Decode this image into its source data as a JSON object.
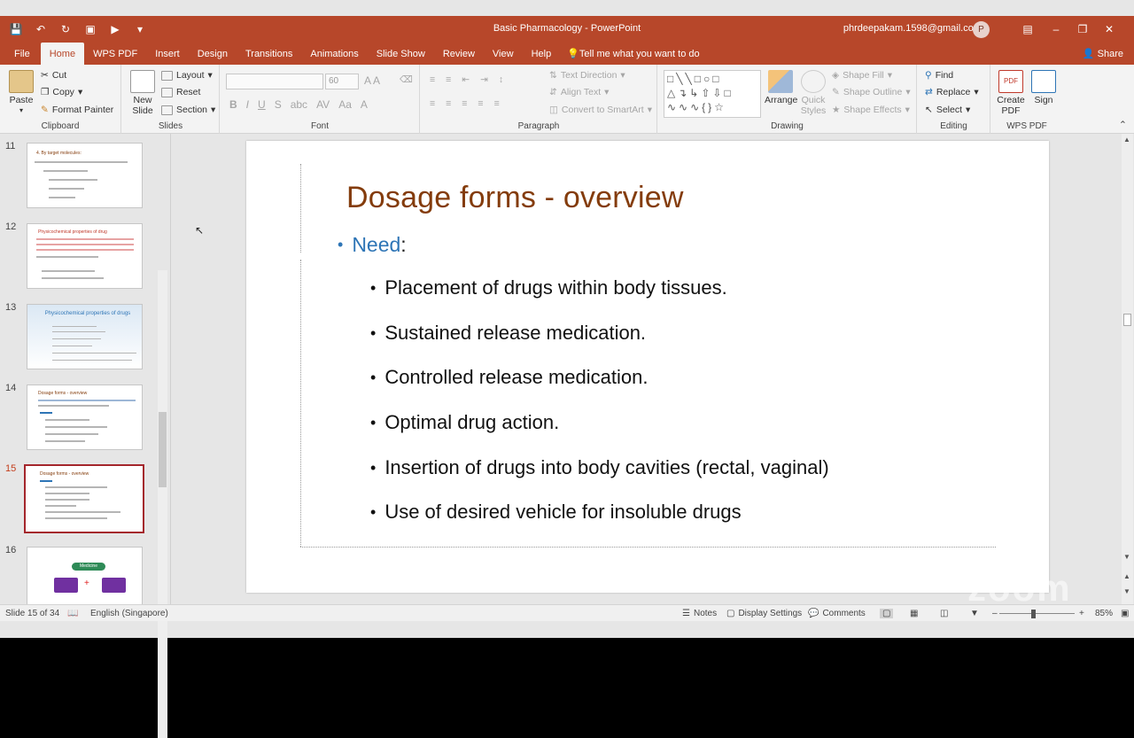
{
  "window": {
    "title": "Basic Pharmacology - PowerPoint",
    "account": "phrdeepakam.1598@gmail.com",
    "avatar_initial": "P"
  },
  "tabs": [
    "File",
    "Home",
    "WPS PDF",
    "Insert",
    "Design",
    "Transitions",
    "Animations",
    "Slide Show",
    "Review",
    "View",
    "Help"
  ],
  "active_tab": "Home",
  "tell_me": "Tell me what you want to do",
  "share": "Share",
  "ribbon": {
    "clipboard": {
      "paste": "Paste",
      "cut": "Cut",
      "copy": "Copy",
      "format_painter": "Format Painter",
      "label": "Clipboard"
    },
    "slides": {
      "new_slide": "New Slide",
      "layout": "Layout",
      "reset": "Reset",
      "section": "Section",
      "label": "Slides"
    },
    "font": {
      "size": "60",
      "label": "Font"
    },
    "paragraph": {
      "text_direction": "Text Direction",
      "align_text": "Align Text",
      "smartart": "Convert to SmartArt",
      "label": "Paragraph"
    },
    "drawing": {
      "arrange": "Arrange",
      "quick_styles": "Quick Styles",
      "shape_fill": "Shape Fill",
      "shape_outline": "Shape Outline",
      "shape_effects": "Shape Effects",
      "label": "Drawing"
    },
    "editing": {
      "find": "Find",
      "replace": "Replace",
      "select": "Select",
      "label": "Editing"
    },
    "wps": {
      "create_pdf": "Create PDF",
      "sign": "Sign",
      "label": "WPS PDF"
    }
  },
  "thumbnails": [
    {
      "num": "11",
      "title": "4. By target molecules:"
    },
    {
      "num": "12",
      "title": "Physicochemical properties of drug"
    },
    {
      "num": "13",
      "title": "Physicochemical properties of drugs"
    },
    {
      "num": "14",
      "title": "Dosage forms - overview"
    },
    {
      "num": "15",
      "title": "Dosage forms - overview"
    },
    {
      "num": "16",
      "title": "Medicine"
    }
  ],
  "slide": {
    "title": "Dosage forms - overview",
    "need_word": "Need",
    "need_colon": ":",
    "bullets": [
      "Placement of drugs within body tissues.",
      "Sustained release medication.",
      "Controlled release medication.",
      "Optimal drug action.",
      "Insertion of drugs into body cavities (rectal, vaginal)",
      "Use of desired vehicle for insoluble drugs"
    ]
  },
  "status": {
    "slide_of": "Slide 15 of 34",
    "language": "English (Singapore)",
    "notes": "Notes",
    "display_settings": "Display Settings",
    "comments": "Comments",
    "zoom": "85%"
  },
  "watermark": "zoom"
}
